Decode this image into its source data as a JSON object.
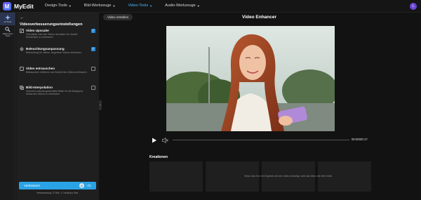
{
  "app": {
    "name": "MyEdit",
    "logo_letter": "M",
    "user_initial": "L"
  },
  "topnav": [
    {
      "label": "Design-Tools",
      "active": false
    },
    {
      "label": "Bild-Werkzeuge",
      "active": false
    },
    {
      "label": "Video-Tools",
      "active": true
    },
    {
      "label": "Audio-Werkzeuge",
      "active": false
    }
  ],
  "rail": [
    {
      "label": "AI-Tools",
      "icon": "sparkle-icon",
      "active": true
    },
    {
      "label": "Allgemeine Tools",
      "icon": "tools-icon",
      "active": false
    }
  ],
  "panel": {
    "back_icon": "←",
    "title": "Videoverbesserungseinstellungen",
    "options": [
      {
        "title": "Video Upscaler",
        "desc": "Geschärfte oder alte Videos hochladen für visuelle Deutlichkeit zu verbessern",
        "checked": true,
        "icon": "upscale-icon"
      },
      {
        "title": "Beleuchtungsanpassung",
        "desc": "Beleuchtung für hellere, eingetönte Videos verbessern",
        "checked": true,
        "icon": "lighting-icon"
      },
      {
        "title": "Video entrauschen",
        "desc": "Bildrauschen entfernen und Klarheit des Videos verbessern",
        "checked": false,
        "icon": "denoise-icon"
      },
      {
        "title": "Bild-Interpolation",
        "desc": "Generiert zwischengeschaltete Bilder für die flüssigeres Ablauf des Videos zu verbessern",
        "checked": false,
        "icon": "interpolation-icon"
      }
    ],
    "apply_label": "Verbessern",
    "credit_icon": "credit-icon",
    "credit_count": "-72",
    "footnote": "Verbrauchung 72 Sek. 1 Credit pro Sek."
  },
  "main": {
    "create_label": "Video erstellen",
    "title": "Video Enhancer",
    "player": {
      "current_time": "00:00",
      "total_time": "00:17",
      "progress": 0.0
    },
    "creations_label": "Kreationen",
    "creations_empty": "Bevor das Tool ein Ergebnis mit den Video hinzufügt, wird das Video die Zeit erhält."
  },
  "colors": {
    "accent": "#2aa3e6",
    "nav_active": "#4db7ff",
    "checkbox_on": "#2a8bd8",
    "background": "#121212",
    "panel": "#1f1f1f"
  }
}
